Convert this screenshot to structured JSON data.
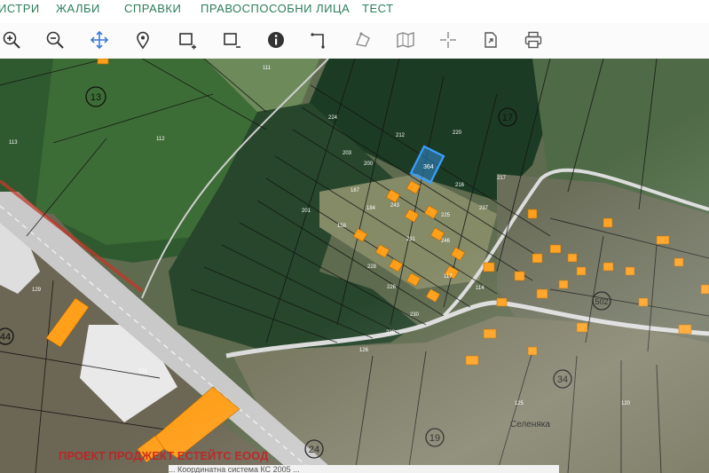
{
  "menu": {
    "items": [
      {
        "label": "ИСТРИ"
      },
      {
        "label": "ЖАЛБИ"
      },
      {
        "label": "СПРАВКИ"
      },
      {
        "label": "ПРАВОСПОСОБНИ ЛИЦА"
      },
      {
        "label": "ТЕСТ"
      }
    ]
  },
  "toolbar": {
    "tools": [
      {
        "icon": "zoom-in-icon"
      },
      {
        "icon": "zoom-out-icon"
      },
      {
        "icon": "pan-icon"
      },
      {
        "icon": "location-pin-icon"
      },
      {
        "icon": "select-add-icon"
      },
      {
        "icon": "select-remove-icon"
      },
      {
        "icon": "info-icon"
      },
      {
        "icon": "measure-line-icon"
      },
      {
        "icon": "draw-icon"
      },
      {
        "icon": "map-layers-icon"
      },
      {
        "icon": "crosshair-icon"
      },
      {
        "icon": "export-icon"
      },
      {
        "icon": "print-icon"
      }
    ]
  },
  "map": {
    "selected_parcel": "364",
    "parcel_labels": [
      "111",
      "112",
      "113",
      "187",
      "243",
      "184",
      "231",
      "228",
      "246",
      "117",
      "114",
      "225",
      "220",
      "237",
      "226",
      "158",
      "200",
      "203",
      "212",
      "224",
      "230",
      "216",
      "217",
      "201",
      "239",
      "131",
      "129",
      "126",
      "125",
      "120"
    ],
    "region_markers": [
      "13",
      "17",
      "24",
      "502",
      "34",
      "19",
      "44"
    ],
    "place_label": "Селеняка",
    "colors": {
      "selected": "#3aa0ff",
      "building": "#ff9f1a",
      "road": "#d9d9d9",
      "parcel_line": "#141414",
      "field_dark": "#1f4a2c",
      "field_light": "#7c8f62"
    }
  },
  "watermark": "ПРОЕКТ ПРОДЖЕКТ ЕСТЕЙТС ЕООД",
  "status": "... Координатна система КС 2005 ..."
}
